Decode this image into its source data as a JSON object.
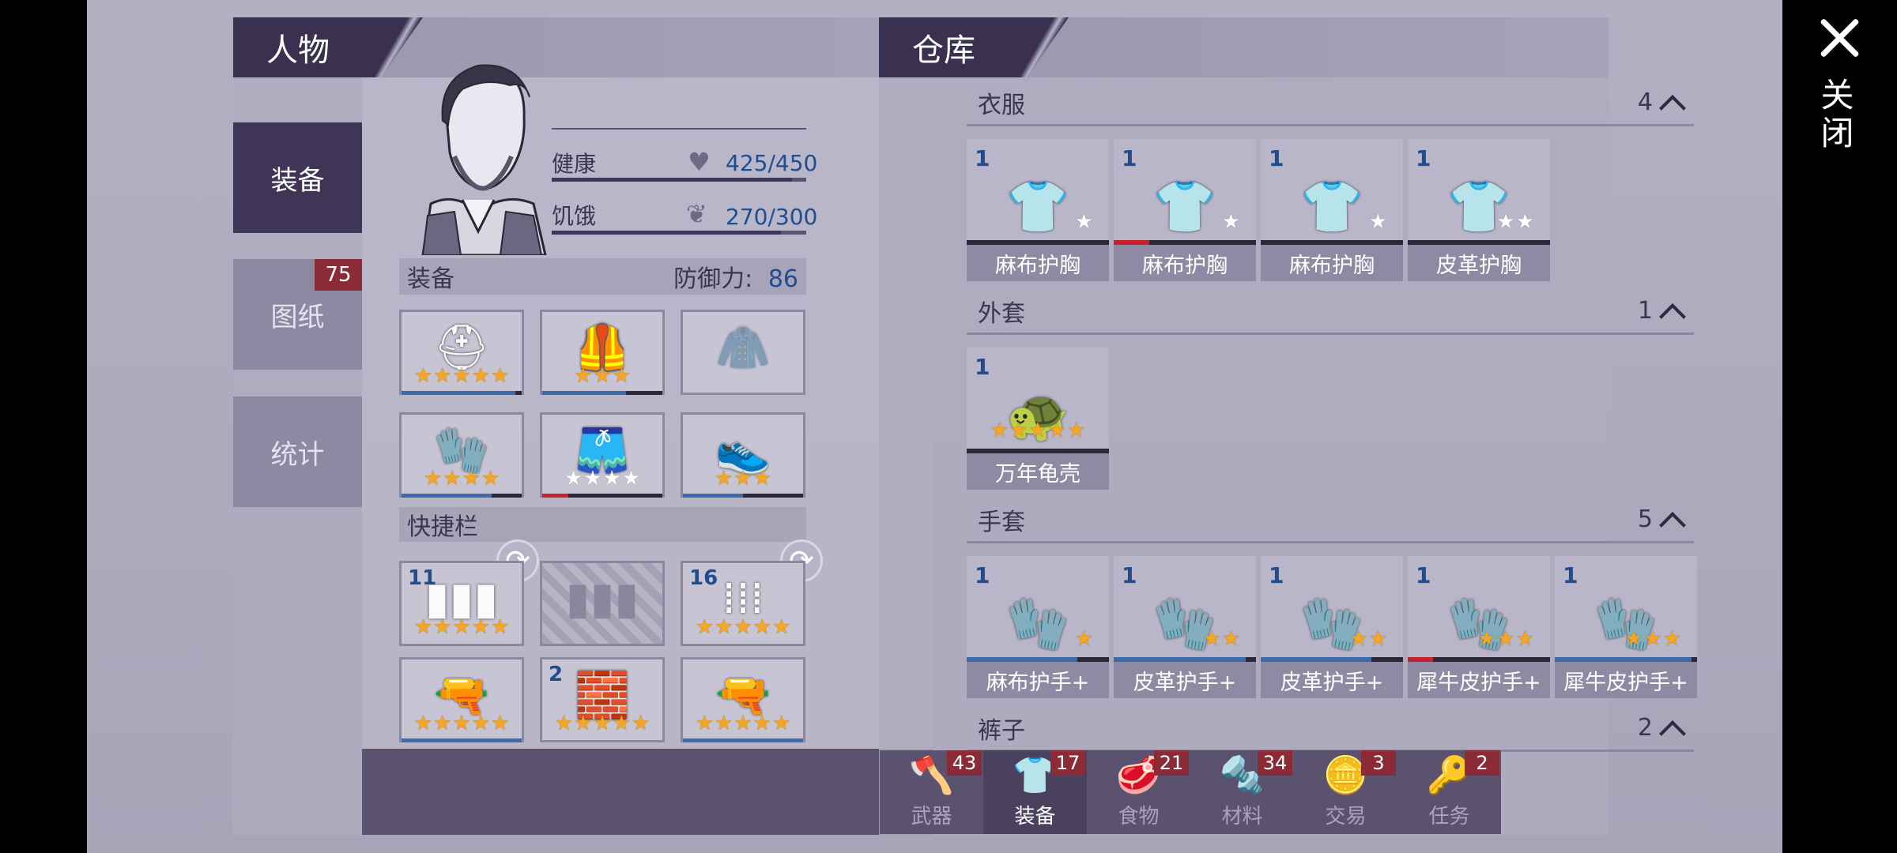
{
  "character_panel": {
    "title": "人物",
    "side_tabs": [
      {
        "label": "装备",
        "active": true
      },
      {
        "label": "图纸",
        "badge": "75"
      },
      {
        "label": "统计"
      }
    ],
    "stats": {
      "health": {
        "label": "健康",
        "value": "425/450",
        "fraction": 0.944
      },
      "hunger": {
        "label": "饥饿",
        "value": "270/300",
        "fraction": 0.9
      }
    },
    "equipment": {
      "title": "装备",
      "defense_label": "防御力:",
      "defense_value": "86",
      "slots": [
        {
          "icon": "helmet-icon",
          "glyph": "⛑",
          "stars_gold": 5,
          "stars_white": 0,
          "durability": 0.95
        },
        {
          "icon": "armor-vest-icon",
          "glyph": "🦺",
          "stars_gold": 3,
          "stars_white": 0,
          "durability": 0.7
        },
        {
          "icon": "jacket-empty-icon",
          "glyph": "🧥",
          "stars_gold": 0,
          "stars_white": 0,
          "durability": null
        },
        {
          "icon": "gloves-icon",
          "glyph": "🧤",
          "stars_gold": 4,
          "stars_white": 0,
          "durability": 0.75
        },
        {
          "icon": "shorts-icon",
          "glyph": "🩳",
          "stars_gold": 0,
          "stars_white": 4,
          "durability": 0.22,
          "low": true
        },
        {
          "icon": "boots-icon",
          "glyph": "👟",
          "stars_gold": 3,
          "stars_white": 0,
          "durability": 0.5
        }
      ]
    },
    "hotbar": {
      "title": "快捷栏",
      "slots": [
        {
          "icon": "battery-ammo-icon",
          "glyph": "▮▮▮",
          "count": "11",
          "stars_gold": 5,
          "durability": null
        },
        {
          "icon": "empty-ammo-slot-icon",
          "glyph": "▮▮▮",
          "count": "",
          "stars_gold": 0,
          "durability": null,
          "empty": true
        },
        {
          "icon": "rifle-bullets-icon",
          "glyph": "⁞⁞⁞",
          "count": "16",
          "stars_gold": 5,
          "durability": null
        },
        {
          "icon": "shotgun-icon",
          "glyph": "🔫",
          "count": "",
          "stars_gold": 5,
          "durability": 1.0
        },
        {
          "icon": "brick-icon",
          "glyph": "🧱",
          "count": "2",
          "stars_gold": 5,
          "durability": null
        },
        {
          "icon": "rifle-icon",
          "glyph": "🔫",
          "count": "",
          "stars_gold": 5,
          "durability": 1.0
        }
      ]
    }
  },
  "warehouse": {
    "title": "仓库",
    "sections": [
      {
        "label": "衣服",
        "count": "4",
        "items": [
          {
            "count": "1",
            "name": "麻布护胸",
            "icon": "cloth-shirt-icon",
            "glyph": "👕",
            "stars_gold": 0,
            "stars_white": 1,
            "durability": 1.0,
            "dur_color": "dark"
          },
          {
            "count": "1",
            "name": "麻布护胸",
            "icon": "cloth-shirt-icon",
            "glyph": "👕",
            "stars_gold": 0,
            "stars_white": 1,
            "durability": 0.25,
            "dur_color": "red"
          },
          {
            "count": "1",
            "name": "麻布护胸",
            "icon": "cloth-shirt-icon",
            "glyph": "👕",
            "stars_gold": 0,
            "stars_white": 1,
            "durability": 1.0,
            "dur_color": "dark"
          },
          {
            "count": "1",
            "name": "皮革护胸",
            "icon": "leather-shirt-icon",
            "glyph": "👕",
            "stars_gold": 0,
            "stars_white": 2,
            "durability": 1.0,
            "dur_color": "dark"
          }
        ]
      },
      {
        "label": "外套",
        "count": "1",
        "items": [
          {
            "count": "1",
            "name": "万年龟壳",
            "icon": "turtle-shell-icon",
            "glyph": "🐢",
            "stars_gold": 5,
            "stars_white": 0,
            "durability": 1.0,
            "dur_color": "dark",
            "center": true
          }
        ]
      },
      {
        "label": "手套",
        "count": "5",
        "items": [
          {
            "count": "1",
            "name": "麻布护手+",
            "icon": "cloth-gloves-icon",
            "glyph": "🧤",
            "stars_gold": 1,
            "stars_white": 0,
            "durability": 0.78,
            "dur_color": "blue"
          },
          {
            "count": "1",
            "name": "皮革护手+",
            "icon": "leather-gloves-icon",
            "glyph": "🧤",
            "stars_gold": 2,
            "stars_white": 0,
            "durability": 0.93,
            "dur_color": "blue"
          },
          {
            "count": "1",
            "name": "皮革护手+",
            "icon": "leather-gloves-icon",
            "glyph": "🧤",
            "stars_gold": 2,
            "stars_white": 0,
            "durability": 0.78,
            "dur_color": "blue"
          },
          {
            "count": "1",
            "name": "犀牛皮护手+",
            "icon": "rhino-gloves-icon",
            "glyph": "🧤",
            "stars_gold": 3,
            "stars_white": 0,
            "durability": 0.18,
            "dur_color": "red"
          },
          {
            "count": "1",
            "name": "犀牛皮护手+",
            "icon": "rhino-gloves-icon",
            "glyph": "🧤",
            "stars_gold": 3,
            "stars_white": 0,
            "durability": 0.96,
            "dur_color": "blue"
          }
        ]
      },
      {
        "label": "裤子",
        "count": "2",
        "items": []
      }
    ],
    "bottom_tabs": [
      {
        "label": "武器",
        "badge": "43",
        "icon": "axe-icon",
        "glyph": "🪓"
      },
      {
        "label": "装备",
        "badge": "17",
        "icon": "shirt-icon",
        "glyph": "👕",
        "active": true
      },
      {
        "label": "食物",
        "badge": "21",
        "icon": "food-icon",
        "glyph": "🥩"
      },
      {
        "label": "材料",
        "badge": "34",
        "icon": "materials-icon",
        "glyph": "🔩"
      },
      {
        "label": "交易",
        "badge": "3",
        "icon": "trade-coin-icon",
        "glyph": "🪙"
      },
      {
        "label": "任务",
        "badge": "2",
        "icon": "key-icon",
        "glyph": "🔑"
      }
    ]
  },
  "close": {
    "label": "关闭"
  },
  "colors": {
    "accent_dark": "#3a3150",
    "value_blue": "#1f4d8f",
    "badge_red": "#8a2b35",
    "star_gold": "#f5a623"
  }
}
